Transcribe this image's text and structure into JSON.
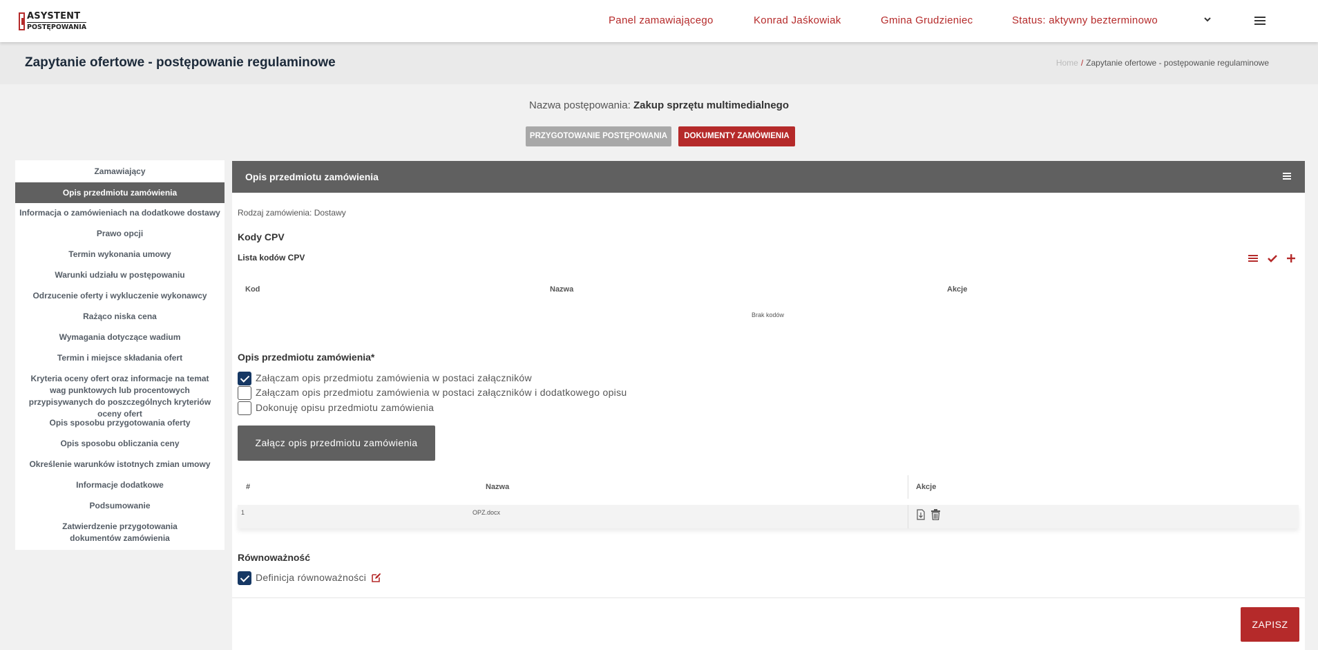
{
  "logo": {
    "line1": "ASYSTENT",
    "line2": "POSTĘPOWANIA"
  },
  "nav": {
    "panel": "Panel zamawiającego",
    "user": "Konrad Jaśkowiak",
    "municipality": "Gmina Grudzieniec",
    "status": "Status: aktywny bezterminowo"
  },
  "page": {
    "title": "Zapytanie ofertowe - postępowanie regulaminowe",
    "breadcrumb_home": "Home",
    "breadcrumb_sep": "/",
    "breadcrumb_current": "Zapytanie ofertowe - postępowanie regulaminowe"
  },
  "procedure": {
    "label": "Nazwa postępowania:",
    "name": "Zakup sprzętu multimedialnego",
    "btn_prep": "PRZYGOTOWANIE POSTĘPOWANIA",
    "btn_docs": "DOKUMENTY ZAMÓWIENIA"
  },
  "sidebar": {
    "items": [
      "Zamawiający",
      "Opis przedmiotu zamówienia",
      "Informacja o zamówieniach na dodatkowe dostawy",
      "Prawo opcji",
      "Termin wykonania umowy",
      "Warunki udziału w postępowaniu",
      "Odrzucenie oferty i wykluczenie wykonawcy",
      "Rażąco niska cena",
      "Wymagania dotyczące wadium",
      "Termin i miejsce składania ofert",
      "Kryteria oceny ofert oraz informacje na temat wag punktowych lub procentowych przypisywanych do poszczególnych kryteriów oceny ofert",
      "Opis sposobu przygotowania oferty",
      "Opis sposobu obliczania ceny",
      "Określenie warunków istotnych zmian umowy",
      "Informacje dodatkowe",
      "Podsumowanie",
      "Zatwierdzenie przygotowania dokumentów zamówienia"
    ],
    "active_index": 1
  },
  "panel": {
    "title": "Opis przedmiotu zamówienia",
    "order_type": "Rodzaj zamówienia: Dostawy",
    "cpv": {
      "heading": "Kody CPV",
      "list_label": "Lista kodów CPV",
      "columns": [
        "Kod",
        "Nazwa",
        "Akcje"
      ],
      "empty_text": "Brak kodów"
    },
    "description": {
      "heading": "Opis przedmiotu zamówienia*",
      "options": [
        {
          "label": "Załączam opis przedmiotu zamówienia w postaci załączników",
          "checked": true
        },
        {
          "label": "Załączam opis przedmiotu zamówienia w postaci załączników i dodatkowego opisu",
          "checked": false
        },
        {
          "label": "Dokonuję opisu przedmiotu zamówienia",
          "checked": false
        }
      ],
      "attach_button": "Załącz opis przedmiotu zamówienia"
    },
    "attachments": {
      "columns": [
        "#",
        "Nazwa",
        "Akcje"
      ],
      "rows": [
        {
          "num": "1",
          "name": "OPZ.docx"
        }
      ]
    },
    "equivalence": {
      "heading": "Równoważność",
      "definition_label": "Definicja równoważności",
      "definition_checked": true
    },
    "save_button": "ZAPISZ"
  },
  "colors": {
    "accent_red": "#b52a2a",
    "panel_gray": "#606060",
    "checkbox_blue": "#163864"
  }
}
